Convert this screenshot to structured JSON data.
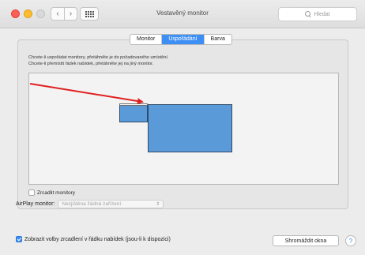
{
  "window": {
    "title": "Vestavěný monitor"
  },
  "toolbar": {
    "back_glyph": "‹",
    "forward_glyph": "›",
    "search_placeholder": "Hledat"
  },
  "tabs": [
    {
      "label": "Monitor",
      "active": false
    },
    {
      "label": "Uspořádání",
      "active": true
    },
    {
      "label": "Barva",
      "active": false
    }
  ],
  "arrangement": {
    "instruction_1": "Chcete-li uspořádat monitory, přetáhněte je do požadovaného umístění.",
    "instruction_2": "Chcete-li přemístit řádek nabídek, přetáhněte jej na jiný monitor.",
    "mirror_label": "Zrcadlit monitory",
    "mirror_checked": false
  },
  "airplay": {
    "label": "AirPlay monitor:",
    "selected": "Nezjištěna žádná zařízení"
  },
  "footer": {
    "show_mirroring_label": "Zobrazit volby zrcadlení v řádku nabídek (jsou-li k dispozici)",
    "show_mirroring_checked": true,
    "gather_windows_label": "Shromáždit okna",
    "help_glyph": "?"
  },
  "colors": {
    "accent": "#3d8ef5",
    "monitor_fill": "#5a9ad8",
    "arrow": "#e02020"
  }
}
